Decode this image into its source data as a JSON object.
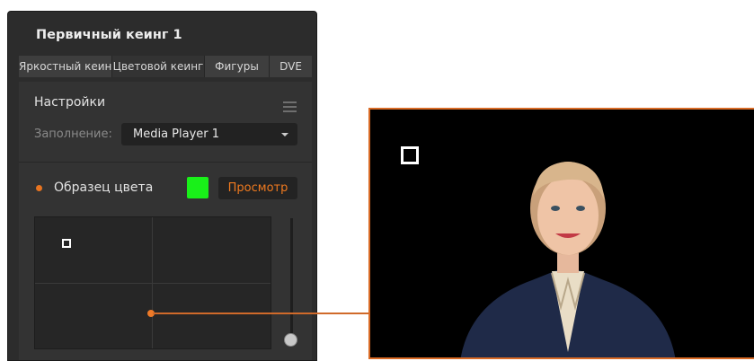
{
  "panel": {
    "title": "Первичный кеинг 1",
    "tabs": [
      {
        "label": "Яркостный кеинг"
      },
      {
        "label": "Цветовой кеинг"
      },
      {
        "label": "Фигуры"
      },
      {
        "label": "DVE"
      }
    ],
    "settings": {
      "title": "Настройки",
      "fill_label": "Заполнение:",
      "fill_value": "Media Player 1"
    },
    "color_sample": {
      "label": "Образец цвета",
      "swatch_color": "#19f019",
      "preview_button": "Просмотр"
    }
  },
  "colors": {
    "accent": "#f07a1f",
    "panel_bg": "#2c2c2c"
  },
  "icons": [
    "menu-icon",
    "chevron-down-icon"
  ]
}
